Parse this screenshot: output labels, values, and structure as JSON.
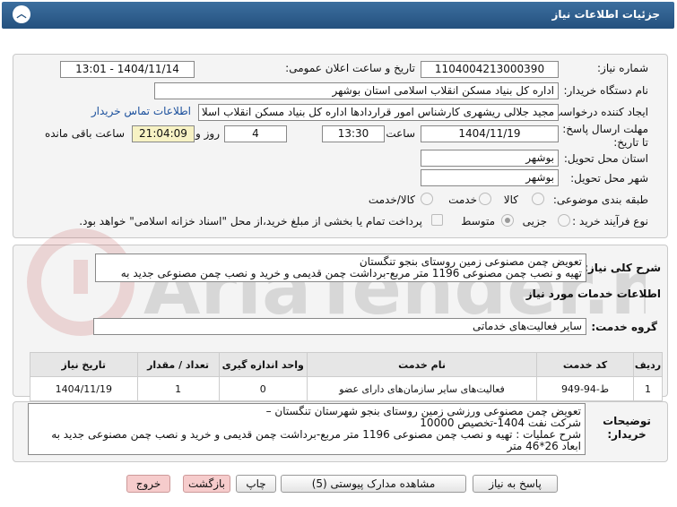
{
  "header": {
    "title": "جزئیات اطلاعات نیاز",
    "collapse_icon": "chevron-up-icon"
  },
  "fields": {
    "need_number_label": "شماره نیاز:",
    "need_number": "1104004213000390",
    "announce_label": "تاریخ و ساعت اعلان عمومی:",
    "announce_value": "1404/11/14 - 13:01",
    "buyer_org_label": "نام دستگاه خریدار:",
    "buyer_org": "اداره کل بنیاد مسکن انقلاب اسلامی استان بوشهر",
    "creator_label": "ایجاد کننده درخواست:",
    "creator": "مجید جلالی ریشهری کارشناس امور قراردادها اداره کل بنیاد مسکن انقلاب اسلا",
    "contact_link": "اطلاعات تماس خریدار",
    "deadline_label": "مهلت ارسال پاسخ: تا تاریخ:",
    "deadline_date": "1404/11/19",
    "time_label": "ساعت",
    "deadline_time": "13:30",
    "days": "4",
    "days_label": "روز و",
    "remaining": "21:04:09",
    "remaining_label": "ساعت باقی مانده",
    "province_label": "استان محل تحویل:",
    "province": "بوشهر",
    "city_label": "شهر محل تحویل:",
    "city": "بوشهر",
    "category_label": "طبقه بندی موضوعی:",
    "category_options": [
      "کالا",
      "خدمت",
      "کالا/خدمت"
    ],
    "process_label": "نوع فرآیند خرید :",
    "process_options": [
      "جزیی",
      "متوسط"
    ],
    "payment_note": "پرداخت تمام یا بخشی از مبلغ خرید،از محل \"اسناد خزانه اسلامی\" خواهد بود."
  },
  "summary": {
    "label": "شرح کلی نیاز:",
    "text": "تعویض چمن مصنوعی زمین روستای بنجو  تنگستان\nتهیه و نصب چمن مصنوعی 1196 متر مربع-برداشت چمن قدیمی و خرید و نصب چمن مصنوعی جدید به"
  },
  "services": {
    "section_title": "اطلاعات خدمات مورد نیاز",
    "group_label": "گروه خدمت:",
    "group_value": "سایر فعالیت‌های خدماتی",
    "columns": [
      "ردیف",
      "کد خدمت",
      "نام خدمت",
      "واحد اندازه گیری",
      "تعداد / مقدار",
      "تاریخ نیاز"
    ],
    "rows": [
      {
        "row": "1",
        "code": "ط-94-949",
        "name": "فعالیت‌های سایر سازمان‌های دارای عضو",
        "unit": "0",
        "qty": "1",
        "date": "1404/11/19"
      }
    ]
  },
  "buyer_notes": {
    "label": "توضیحات خریدار:",
    "text": "تعویض چمن مصنوعی ورزشی زمین روستای بنجو  شهرستان تنگستان –\nشرکت نفت 1404-تخصیص 10000\nشرح عملیات : تهیه و نصب چمن مصنوعی 1196 متر مربع-برداشت چمن قدیمی و خرید و نصب چمن مصنوعی جدید به\nابعاد 26*46 متر"
  },
  "buttons": {
    "reply": "پاسخ به نیاز",
    "docs": "مشاهده مدارک پیوستی (5)",
    "print": "چاپ",
    "back": "بازگشت",
    "exit": "خروج"
  },
  "colors": {
    "header": "#2c5b8a",
    "exit_button": "#f6cccc",
    "link": "#1a4f9c"
  }
}
